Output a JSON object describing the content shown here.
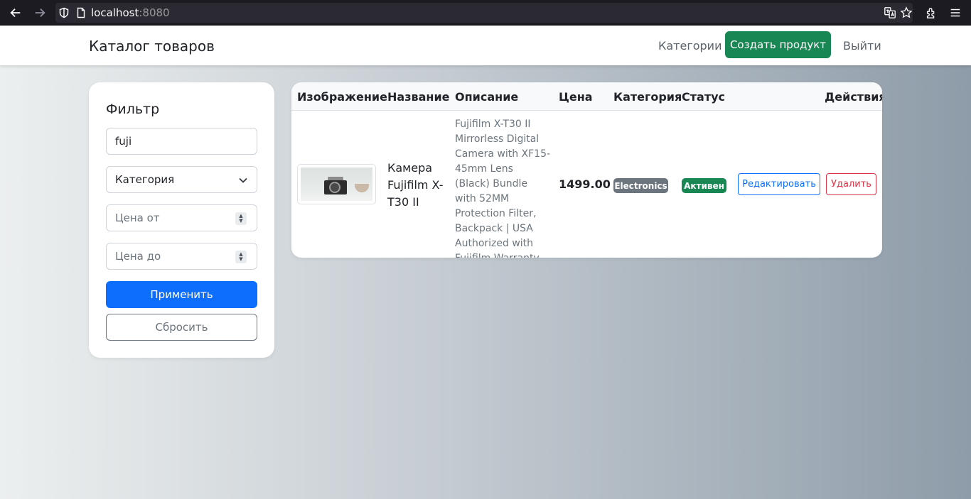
{
  "browser": {
    "url_host": "localhost",
    "url_port": ":8080"
  },
  "navbar": {
    "brand": "Каталог товаров",
    "categories_link": "Категории",
    "create_button": "Создать продукт",
    "logout_link": "Выйти"
  },
  "filter": {
    "title": "Фильтр",
    "search_value": "fuji",
    "category_select": "Категория",
    "price_from_placeholder": "Цена от",
    "price_to_placeholder": "Цена до",
    "apply_button": "Применить",
    "reset_button": "Сбросить"
  },
  "table": {
    "headers": [
      "Изображение",
      "Название",
      "Описание",
      "Цена",
      "Категория",
      "Статус",
      "Действия"
    ],
    "rows": [
      {
        "name": "Камера Fujifilm X-T30 II",
        "description": "Fujifilm X-T30 II Mirrorless Digital Camera with XF15-45mm Lens (Black) Bundle with 52MM Protection Filter, Backpack | USA Authorized with Fujifilm Warranty",
        "price": "1499.00",
        "category": "Electronics",
        "status": "Активен",
        "edit_button": "Редактировать",
        "delete_button": "Удалить"
      }
    ]
  },
  "colors": {
    "primary": "#0d6efd",
    "success": "#198754",
    "danger": "#dc3545",
    "secondary": "#6c757d"
  }
}
